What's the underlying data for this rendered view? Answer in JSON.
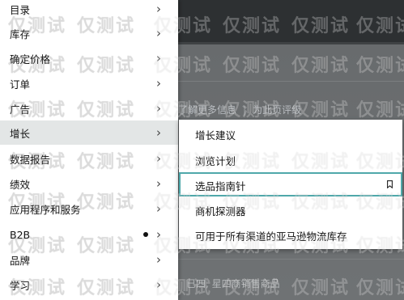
{
  "main_menu": {
    "items": [
      {
        "label": "目录"
      },
      {
        "label": "库存"
      },
      {
        "label": "确定价格"
      },
      {
        "label": "订单"
      },
      {
        "label": "广告"
      },
      {
        "label": "增长"
      },
      {
        "label": "数据报告"
      },
      {
        "label": "绩效"
      },
      {
        "label": "应用程序和服务"
      },
      {
        "label": "B2B"
      },
      {
        "label": "品牌"
      },
      {
        "label": "学习"
      }
    ],
    "active_item": "增长",
    "chevron": "›"
  },
  "sub_menu": {
    "items": [
      {
        "label": "增长建议"
      },
      {
        "label": "浏览计划"
      },
      {
        "label": "选品指南针"
      },
      {
        "label": "商机探测器"
      },
      {
        "label": "可用于所有渠道的亚马逊物流库存"
      }
    ],
    "highlighted_item": "选品指南针"
  },
  "background_page": {
    "links_left": "了解更多信息",
    "links_separator": "|",
    "links_right": "为此页评级",
    "bottom_text": "已四, 星四商销售商品"
  },
  "watermark_text": "仅测试",
  "colors": {
    "highlight_border": "#4fa8aa",
    "active_bg": "#e3e6e6",
    "overlay": "#5a5d5f"
  }
}
